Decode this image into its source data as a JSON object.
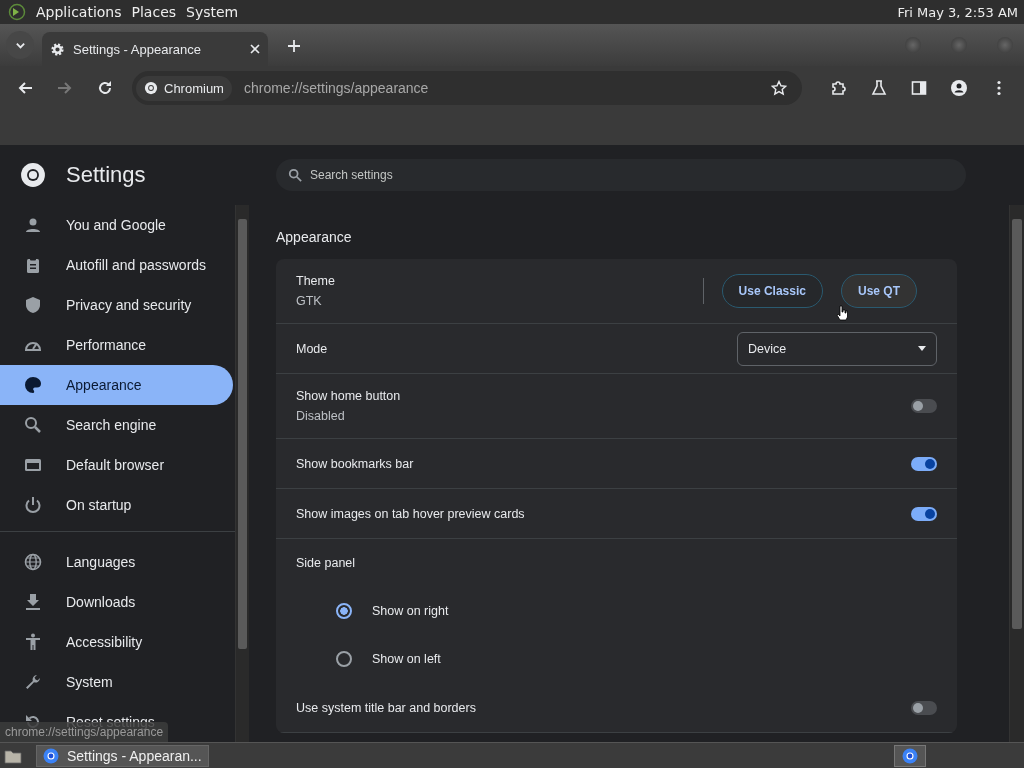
{
  "top_panel": {
    "menus": [
      "Applications",
      "Places",
      "System"
    ],
    "clock": "Fri May 3,  2:53 AM"
  },
  "tabs": [
    {
      "title": "Settings - Appearance",
      "selected": true
    }
  ],
  "address_bar": {
    "chip": "Chromium",
    "url": "chrome://settings/appearance"
  },
  "settings": {
    "title": "Settings",
    "search_placeholder": "Search settings",
    "nav": [
      {
        "label": "You and Google",
        "selected": false
      },
      {
        "label": "Autofill and passwords",
        "selected": false
      },
      {
        "label": "Privacy and security",
        "selected": false
      },
      {
        "label": "Performance",
        "selected": false
      },
      {
        "label": "Appearance",
        "selected": true
      },
      {
        "label": "Search engine",
        "selected": false
      },
      {
        "label": "Default browser",
        "selected": false
      },
      {
        "label": "On startup",
        "selected": false
      },
      {
        "label": "Languages",
        "selected": false
      },
      {
        "label": "Downloads",
        "selected": false
      },
      {
        "label": "Accessibility",
        "selected": false
      },
      {
        "label": "System",
        "selected": false
      },
      {
        "label": "Reset settings",
        "selected": false
      }
    ],
    "section": "Appearance",
    "rows": [
      {
        "kind": "theme",
        "label": "Theme",
        "value": "GTK",
        "buttons": [
          "Use Classic",
          "Use QT"
        ]
      },
      {
        "kind": "select",
        "label": "Mode",
        "value": "Device"
      },
      {
        "kind": "toggle",
        "label": "Show home button",
        "sublabel": "Disabled",
        "on": false
      },
      {
        "kind": "toggle",
        "label": "Show bookmarks bar",
        "on": true
      },
      {
        "kind": "toggle",
        "label": "Show images on tab hover preview cards",
        "on": true
      },
      {
        "kind": "heading",
        "label": "Side panel"
      },
      {
        "kind": "radio",
        "label": "Show on right",
        "selected": true
      },
      {
        "kind": "radio",
        "label": "Show on left",
        "selected": false
      },
      {
        "kind": "toggle",
        "label": "Use system title bar and borders",
        "on": false
      }
    ]
  },
  "status_bubble": "chrome://settings/appearance",
  "taskbar": {
    "window": "Settings - Appearan..."
  }
}
